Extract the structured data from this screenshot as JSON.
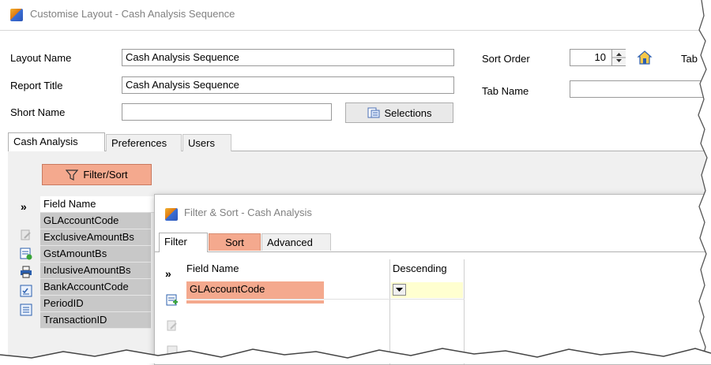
{
  "window": {
    "title": "Customise Layout - Cash Analysis Sequence"
  },
  "form": {
    "layout_name_label": "Layout Name",
    "layout_name_value": "Cash Analysis Sequence",
    "report_title_label": "Report Title",
    "report_title_value": "Cash Analysis Sequence",
    "short_name_label": "Short Name",
    "short_name_value": "",
    "selections_button": "Selections",
    "sort_order_label": "Sort Order",
    "sort_order_value": "10",
    "tab_name_label": "Tab Name",
    "tab_name_value": "",
    "tab_label_truncated": "Tab"
  },
  "tabs": [
    {
      "label": "Cash Analysis"
    },
    {
      "label": "Preferences"
    },
    {
      "label": "Users"
    }
  ],
  "filter_sort_button": "Filter/Sort",
  "grid": {
    "expand_glyph": "»",
    "header": "Field Name",
    "rows": [
      "GLAccountCode",
      "ExclusiveAmountBs",
      "GstAmountBs",
      "InclusiveAmountBs",
      "BankAccountCode",
      "PeriodID",
      "TransactionID"
    ]
  },
  "dialog": {
    "title": "Filter & Sort - Cash Analysis",
    "tabs": [
      {
        "label": "Filter"
      },
      {
        "label": "Sort"
      },
      {
        "label": "Advanced"
      }
    ],
    "expand_glyph": "»",
    "columns": [
      "Field Name",
      "Descending"
    ],
    "rows": [
      {
        "field": "GLAccountCode",
        "descending": ""
      }
    ]
  },
  "colors": {
    "highlight": "#f4a98e",
    "grid_row_bg": "#c8c8c8",
    "yellow_cell": "#ffffd0"
  }
}
